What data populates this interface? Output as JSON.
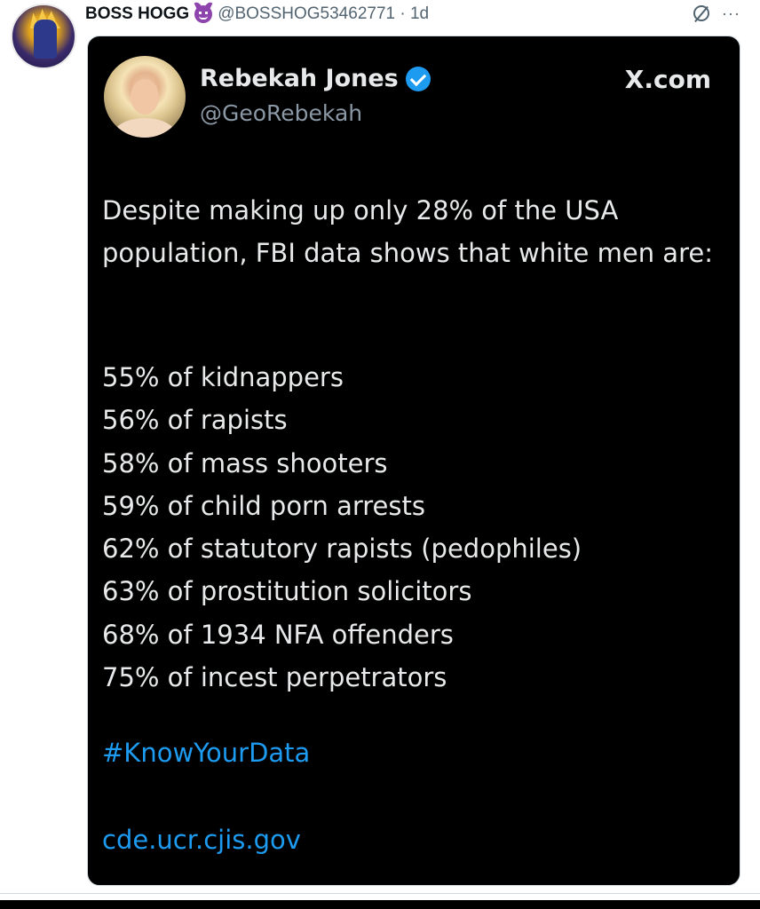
{
  "post": {
    "author_name": "BOSS HOGG",
    "author_emoji": "devil-emoji",
    "handle_and_time": "@BOSSHOG53462771 · 1d",
    "more_label": "···"
  },
  "media": {
    "inner_author_name": "Rebekah Jones",
    "inner_handle": "@GeoRebekah",
    "source_label": "X.com",
    "intro_text": "Despite making up only 28% of the USA population, FBI data shows that white men are:",
    "stats": [
      "55% of kidnappers",
      "56% of rapists",
      "58% of mass shooters",
      "59% of child porn arrests",
      "62% of statutory rapists (pedophiles)",
      "63% of prostitution solicitors",
      "68% of 1934 NFA offenders",
      "75% of incest perpetrators"
    ],
    "hashtag": "#KnowYourData",
    "link": "cde.ucr.cjis.gov"
  },
  "colors": {
    "accent": "#1d9bf0",
    "card_bg": "#000000",
    "text_light": "#e7e9ea",
    "text_muted": "#536471"
  }
}
